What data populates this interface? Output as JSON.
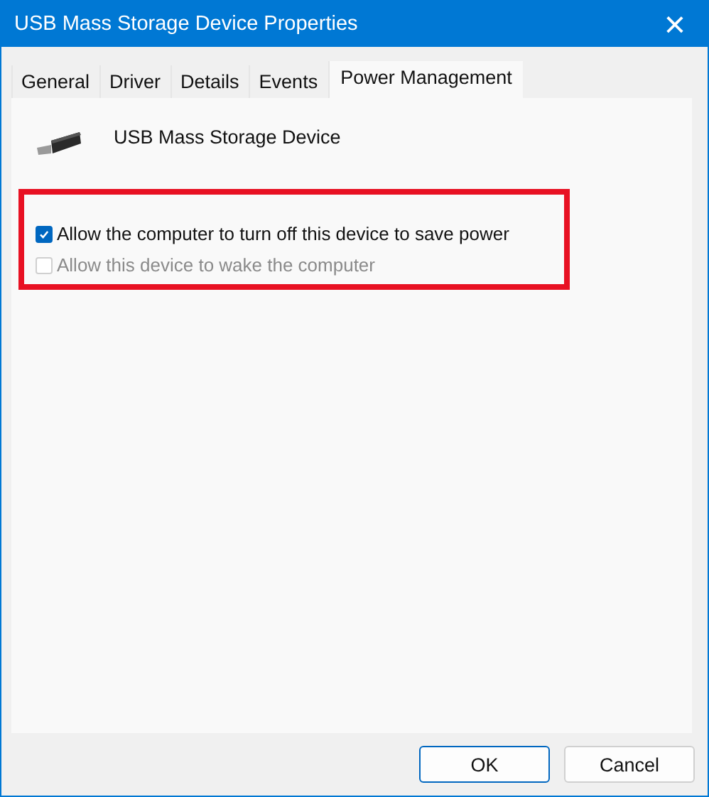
{
  "window": {
    "title": "USB Mass Storage Device Properties",
    "close": "×"
  },
  "tabs": [
    {
      "label": "General",
      "selected": false
    },
    {
      "label": "Driver",
      "selected": false
    },
    {
      "label": "Details",
      "selected": false
    },
    {
      "label": "Events",
      "selected": false
    },
    {
      "label": "Power Management",
      "selected": true
    }
  ],
  "device": {
    "name": "USB Mass Storage Device"
  },
  "options": [
    {
      "label": "Allow the computer to turn off this device to save power",
      "checked": true,
      "disabled": false
    },
    {
      "label": "Allow this device to wake the computer",
      "checked": false,
      "disabled": true
    }
  ],
  "buttons": [
    {
      "label": "OK",
      "default": true
    },
    {
      "label": "Cancel",
      "default": false
    }
  ]
}
